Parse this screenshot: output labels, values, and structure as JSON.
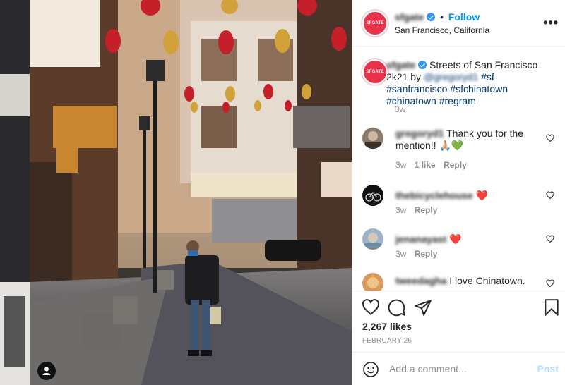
{
  "post": {
    "username": "sfgate",
    "avatar_text": "SFGATE",
    "follow_label": "Follow",
    "separator": "•",
    "location": "San Francisco, California",
    "more_label": "•••"
  },
  "caption": {
    "username": "sfgate",
    "text": "Streets of San Francisco 2k21 by",
    "mention": "@gregoryd1",
    "tags": [
      "#sf",
      "#sanfrancisco",
      "#sfchinatown",
      "#chinatown",
      "#regram"
    ],
    "time": "3w"
  },
  "comments": [
    {
      "username": "gregoryd1",
      "text": "Thank you for the mention!! 🙏🏼💚",
      "time": "3w",
      "likes": "1 like",
      "reply": "Reply"
    },
    {
      "username": "thebicyclehouse",
      "text": "❤️",
      "time": "3w",
      "reply": "Reply"
    },
    {
      "username": "jenanayast",
      "text": "❤️",
      "time": "3w",
      "reply": "Reply"
    },
    {
      "username": "tweedagha",
      "text": "I love Chinatown."
    }
  ],
  "footer": {
    "likes": "2,267 likes",
    "date": "FEBRUARY 26",
    "comment_placeholder": "Add a comment...",
    "post_label": "Post"
  },
  "icons": [
    "user-tag-icon",
    "more-icon",
    "heart-icon",
    "comment-icon",
    "share-icon",
    "bookmark-icon",
    "emoji-icon"
  ],
  "colors": {
    "accent": "#0095f6",
    "verified": "#3897f0",
    "brand": "#e8334a",
    "post_disabled": "#b2dffc",
    "heart_red": "#ed4956"
  }
}
